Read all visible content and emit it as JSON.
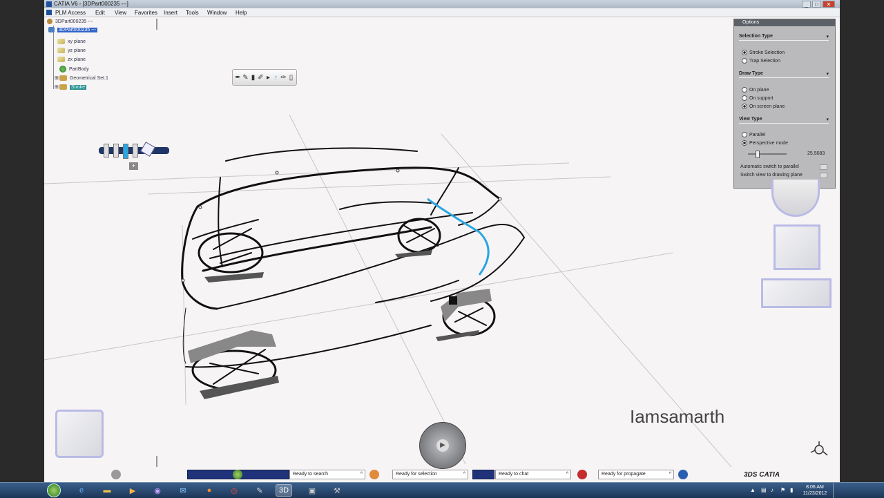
{
  "window": {
    "title": "CATIA V6 - [3DPart000235 ---]",
    "minimize": "_",
    "maximize": "□",
    "close": "✕"
  },
  "menu": [
    "PLM Access",
    "Edit",
    "View",
    "Favorites",
    "Insert",
    "Tools",
    "Window",
    "Help"
  ],
  "tree": {
    "root": "3DPart000235 ---",
    "part": "3DPart000235 ---",
    "items": [
      "xy plane",
      "yz plane",
      "zx plane",
      "PartBody",
      "Geometrical Set.1"
    ],
    "selected_item": "Stroke"
  },
  "options_panel": {
    "header": "Options",
    "selection_type": {
      "title": "Selection Type",
      "options": [
        "Stroke Selection",
        "Trap Selection"
      ],
      "selected": "Stroke Selection"
    },
    "draw_type": {
      "title": "Draw Type",
      "options": [
        "On plane",
        "On support",
        "On screen plane"
      ],
      "selected": "On screen plane"
    },
    "view_type": {
      "title": "View Type",
      "options": [
        "Parallel",
        "Perspective mode"
      ],
      "selected": "Perspective mode",
      "value": "25.5083"
    },
    "checkboxes": [
      "Automatic switch to parallel",
      "Switch view to drawing plane"
    ]
  },
  "watermark": "Iamsamarth",
  "status": {
    "search": "Ready to search",
    "selection": "Ready for selection",
    "chat": "Ready to chat",
    "propagate": "Ready for propagate"
  },
  "brand": "3DS CATIA",
  "clock": {
    "time": "8:06 AM",
    "date": "11/23/2012"
  },
  "colors": {
    "accent_blue": "#2aa6e0",
    "selection": "#3264c8",
    "options_bg": "#afafb2"
  },
  "icons": [
    "pen-icon",
    "pencil-icon",
    "airbrush-icon",
    "eraser-icon",
    "compass-icon",
    "windows-start-icon",
    "ie-icon",
    "folder-icon",
    "media-icon",
    "firefox-icon",
    "chrome-icon",
    "catia-icon"
  ]
}
